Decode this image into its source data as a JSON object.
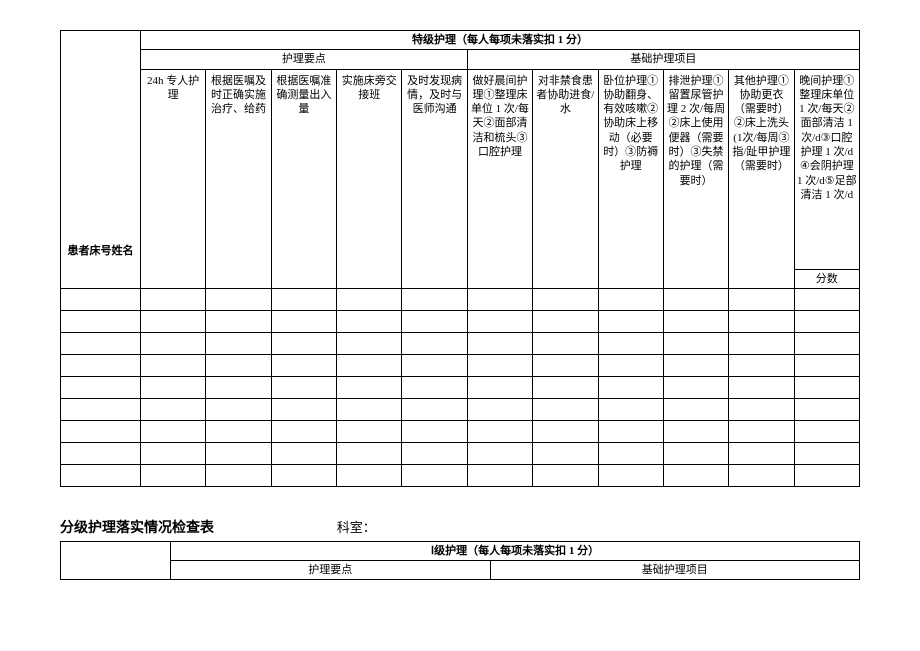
{
  "table1": {
    "mainHeader": "特级护理（每人每项未落实扣 1 分）",
    "groupHeaders": {
      "left": "护理要点",
      "right": "基础护理项目"
    },
    "columns": [
      "24h 专人护理",
      "根据医嘱及时正确实施治疗、给药",
      "根据医嘱准确测量出入量",
      "实施床旁交接班",
      "及时发现病情，及时与医师沟通",
      "做好晨间护理①整理床单位 1 次/每天②面部清洁和梳头③口腔护理",
      "对非禁食患者协助进食/水",
      "卧位护理①协助翻身、有效咳嗽②协助床上移动（必要时）③防褥护理",
      "排泄护理①留置尿管护理 2 次/每周②床上使用便器（需要时）③失禁的护理（需要时）",
      "其他护理①协助更衣（需要时）②床上洗头(1次/每周③指/趾甲护理（需要时）",
      "晚间护理①整理床单位 1 次/每天②面部清洁 1 次/d③口腔护理 1 次/d④会阴护理 1 次/d⑤足部清洁 1 次/d"
    ],
    "rowLabel": "患者床号姓名",
    "scoreLabel": "分数",
    "dataRows": 9
  },
  "section2": {
    "title": "分级护理落实情况检查表",
    "deptLabel": "科室：",
    "mainHeader": "Ⅰ级护理（每人每项未落实扣 1 分）",
    "groupHeaders": {
      "left": "护理要点",
      "right": "基础护理项目"
    }
  }
}
